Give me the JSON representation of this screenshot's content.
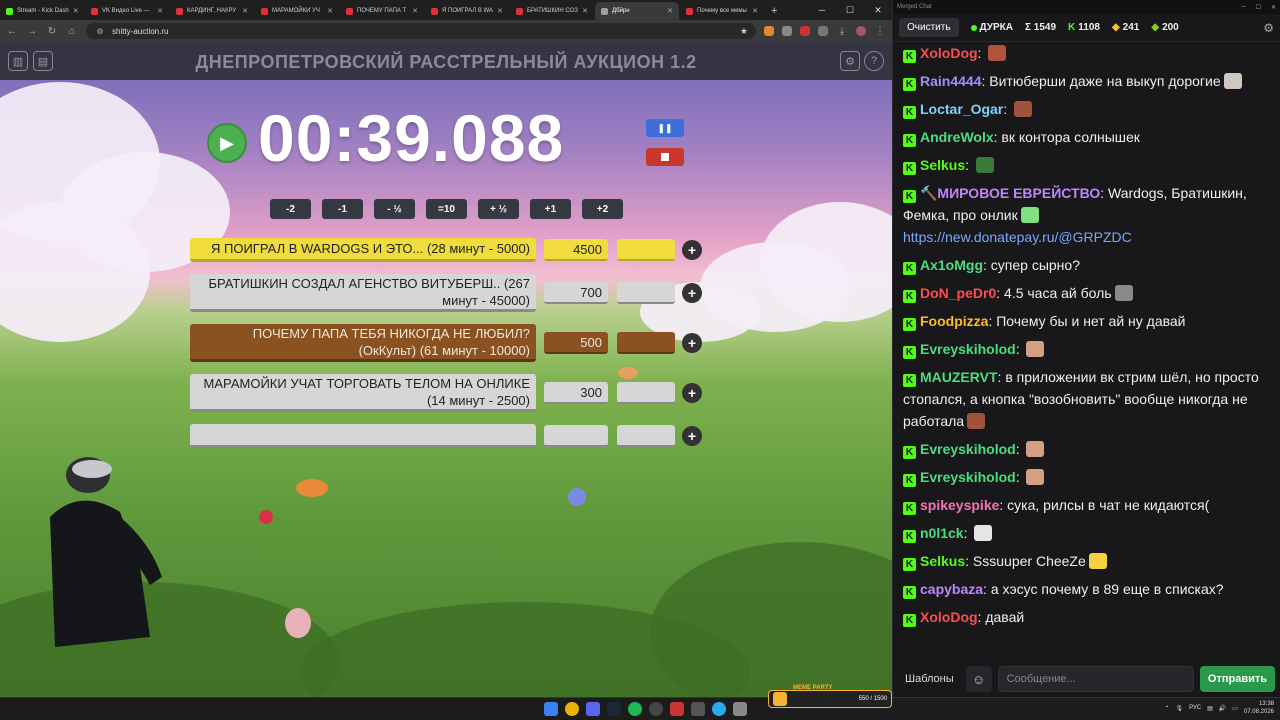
{
  "browser": {
    "tabs": [
      {
        "label": "Stream - Kick Dash",
        "color": "#53fc18",
        "active": false
      },
      {
        "label": "VK Видео Live —",
        "color": "#e0303a",
        "active": false
      },
      {
        "label": "КАРДИНГ, НАКРУ",
        "color": "#e0303a",
        "active": false
      },
      {
        "label": "МАРАМОЙКИ УЧ",
        "color": "#e0303a",
        "active": false
      },
      {
        "label": "ПОЧЕМУ ПАПА Т",
        "color": "#e0303a",
        "active": false
      },
      {
        "label": "Я ПОИГРАЛ В WA",
        "color": "#e0303a",
        "active": false
      },
      {
        "label": "БРАТИШКИН СОЗ",
        "color": "#e0303a",
        "active": false
      },
      {
        "label": "Дбйрн",
        "color": "#9aa0a6",
        "active": true
      },
      {
        "label": "Почему все мемы",
        "color": "#e0303a",
        "active": false
      }
    ],
    "url": "shitty-auction.ru"
  },
  "page": {
    "title": "ДНЕПРОПЕТРОВСКИЙ РАССТРЕЛЬНЫЙ АУКЦИОН 1.2",
    "timer": "00:39.088",
    "adjust_buttons": [
      "-2",
      "-1",
      "- ½",
      "=10",
      "+ ½",
      "+1",
      "+2"
    ]
  },
  "lots": [
    {
      "name": "Я ПОИГРАЛ В WARDOGS И ЭТО... (28 минут - 5000)",
      "amount": "4500",
      "color": "yellow"
    },
    {
      "name": "БРАТИШКИН СОЗДАЛ АГЕНСТВО ВИТУБЕРШ.. (267 минут - 45000)",
      "amount": "700",
      "color": "grey"
    },
    {
      "name": "ПОЧЕМУ ПАПА ТЕБЯ НИКОГДА НЕ ЛЮБИЛ? (ОкКульт) (61 минут - 10000)",
      "amount": "500",
      "color": "brown"
    },
    {
      "name": "МАРАМОЙКИ УЧАТ ТОРГОВАТЬ ТЕЛОМ НА ОНЛИКЕ (14 минут - 2500)",
      "amount": "300",
      "color": "grey"
    },
    {
      "name": "",
      "amount": "",
      "color": "grey"
    }
  ],
  "chat": {
    "window_title": "Merged Chat",
    "clear_label": "Очистить",
    "streamer": "ДУРКА",
    "total": "Σ 1549",
    "kick_count": "1108",
    "count2": "241",
    "count3": "200",
    "templates_label": "Шаблоны",
    "input_placeholder": "Сообщение...",
    "send_label": "Отправить",
    "messages": [
      {
        "user": "XoloDog",
        "color": "#ff4d4d",
        "text": "",
        "emote": "#b0523c"
      },
      {
        "user": "Rain4444",
        "color": "#a78bfa",
        "text": "Витюберши даже на выкуп дорогие",
        "emote": "#cfc7c0"
      },
      {
        "user": "Loctar_Ogar",
        "color": "#7dd3fc",
        "text": "",
        "emote": "#a0523c"
      },
      {
        "user": "AndreWolx",
        "color": "#4ade80",
        "text": "вк контора солнышек",
        "emote": ""
      },
      {
        "user": "Selkus",
        "color": "#53fc18",
        "text": "",
        "emote": "#3a7a3a"
      },
      {
        "user": "🔨МИРОВОЕ ЕВРЕЙСТВО",
        "color": "#c084fc",
        "text": "Wardogs, Братишкин, Фемка, про онлик",
        "emote": "#7ee07e"
      },
      {
        "user": "",
        "color": "#7aa7ff",
        "text": "https://new.donatepay.ru/@GRPZDC",
        "emote": "",
        "link": true
      },
      {
        "user": "Ax1oMgg",
        "color": "#4ade80",
        "text": "супер сырно?",
        "emote": ""
      },
      {
        "user": "DoN_peDr0",
        "color": "#ff4d4d",
        "text": "4.5 часа ай боль",
        "emote": "#8a8a8a"
      },
      {
        "user": "Foodpizza",
        "color": "#fbbf24",
        "text": "Почему бы и нет ай ну давай",
        "emote": ""
      },
      {
        "user": "Evreyskiholod",
        "color": "#4ade80",
        "text": "",
        "emote": "#d4a084"
      },
      {
        "user": "MAUZERVT",
        "color": "#4ade80",
        "text": "в приложении вк стрим шёл, но просто стопался, а кнопка \"возобновить\" вообще никогда не работала",
        "emote": "#a0523c"
      },
      {
        "user": "Evreyskiholod",
        "color": "#4ade80",
        "text": "",
        "emote": "#d4a084"
      },
      {
        "user": "Evreyskiholod",
        "color": "#4ade80",
        "text": "",
        "emote": "#d4a084"
      },
      {
        "user": "spikeyspike",
        "color": "#f472b6",
        "text": "сука, рилсы в чат не кидаются(",
        "emote": ""
      },
      {
        "user": "n0l1ck",
        "color": "#4ade80",
        "text": "",
        "emote": "#e5e5e5"
      },
      {
        "user": "Selkus",
        "color": "#53fc18",
        "text": "Sssuuper CheeZe",
        "emote": "#f5d040"
      },
      {
        "user": "capybaza",
        "color": "#c084fc",
        "text": "а хэсус почему в 89 еще в списках?",
        "emote": ""
      },
      {
        "user": "XoloDog",
        "color": "#ff4d4d",
        "text": "давай",
        "emote": ""
      }
    ]
  },
  "taskbar": {
    "meme_label": "MEME PARTY",
    "meme_progress": "550 / 1500",
    "lang": "РУС",
    "time": "13:38",
    "date": "07.08.2026"
  }
}
